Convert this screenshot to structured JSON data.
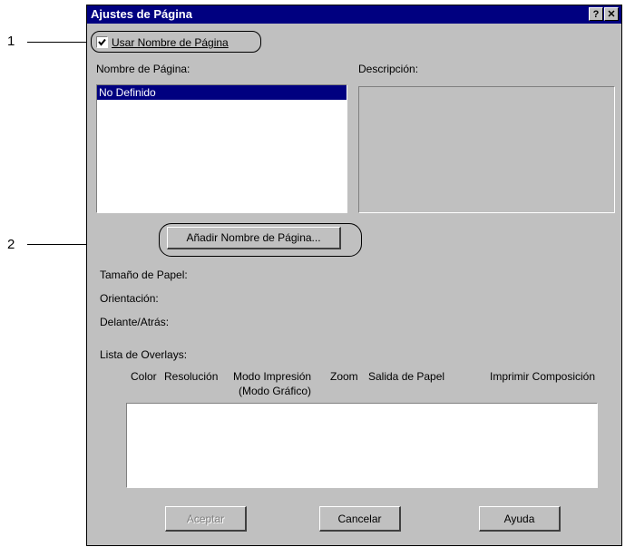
{
  "callouts": [
    "1",
    "2"
  ],
  "dialog": {
    "title": "Ajustes de Página",
    "help_button": "?",
    "close_button": "✕"
  },
  "use_page_name": {
    "label": "Usar Nombre de Página",
    "checked": true
  },
  "page_name": {
    "label": "Nombre de Página:",
    "items": [
      "No Definido"
    ]
  },
  "description": {
    "label": "Descripción:"
  },
  "add_page_name_button": "Añadir Nombre de Página...",
  "info": {
    "paper_size": "Tamaño de Papel:",
    "orientation": "Orientación:",
    "front_back": "Delante/Atrás:"
  },
  "overlay_list": {
    "label": "Lista de Overlays:",
    "columns": [
      "Color",
      "Resolución",
      "Modo Impresión",
      "(Modo Gráfico)",
      "Zoom",
      "Salida de Papel",
      "Imprimir Composición"
    ]
  },
  "buttons": {
    "accept": "Aceptar",
    "cancel": "Cancelar",
    "help": "Ayuda"
  }
}
